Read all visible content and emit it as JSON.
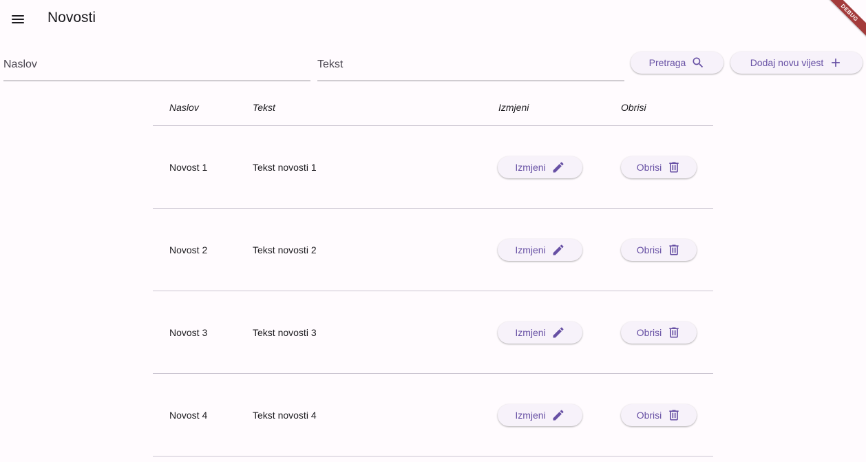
{
  "appbar": {
    "title": "Novosti"
  },
  "debug_banner": "DEBUG",
  "search": {
    "naslov_placeholder": "Naslov",
    "tekst_placeholder": "Tekst",
    "search_button": "Pretraga",
    "add_button": "Dodaj novu vijest"
  },
  "table": {
    "headers": {
      "naslov": "Naslov",
      "tekst": "Tekst",
      "izmjeni": "Izmjeni",
      "obrisi": "Obrisi"
    },
    "rows": [
      {
        "naslov": "Novost 1",
        "tekst": "Tekst novosti 1",
        "edit_label": "Izmjeni",
        "delete_label": "Obrisi"
      },
      {
        "naslov": "Novost 2",
        "tekst": "Tekst novosti 2",
        "edit_label": "Izmjeni",
        "delete_label": "Obrisi"
      },
      {
        "naslov": "Novost 3",
        "tekst": "Tekst novosti 3",
        "edit_label": "Izmjeni",
        "delete_label": "Obrisi"
      },
      {
        "naslov": "Novost 4",
        "tekst": "Tekst novosti 4",
        "edit_label": "Izmjeni",
        "delete_label": "Obrisi"
      }
    ]
  },
  "icons": {
    "menu": "menu-icon",
    "search": "search-icon",
    "add": "plus-icon",
    "edit": "pencil-icon",
    "delete": "trash-icon"
  },
  "colors": {
    "background": "#fffbfe",
    "accent": "#6750a4",
    "button_surface": "#f7f2fa",
    "divider": "#cac4d0",
    "debug_banner": "#a33b3b"
  }
}
